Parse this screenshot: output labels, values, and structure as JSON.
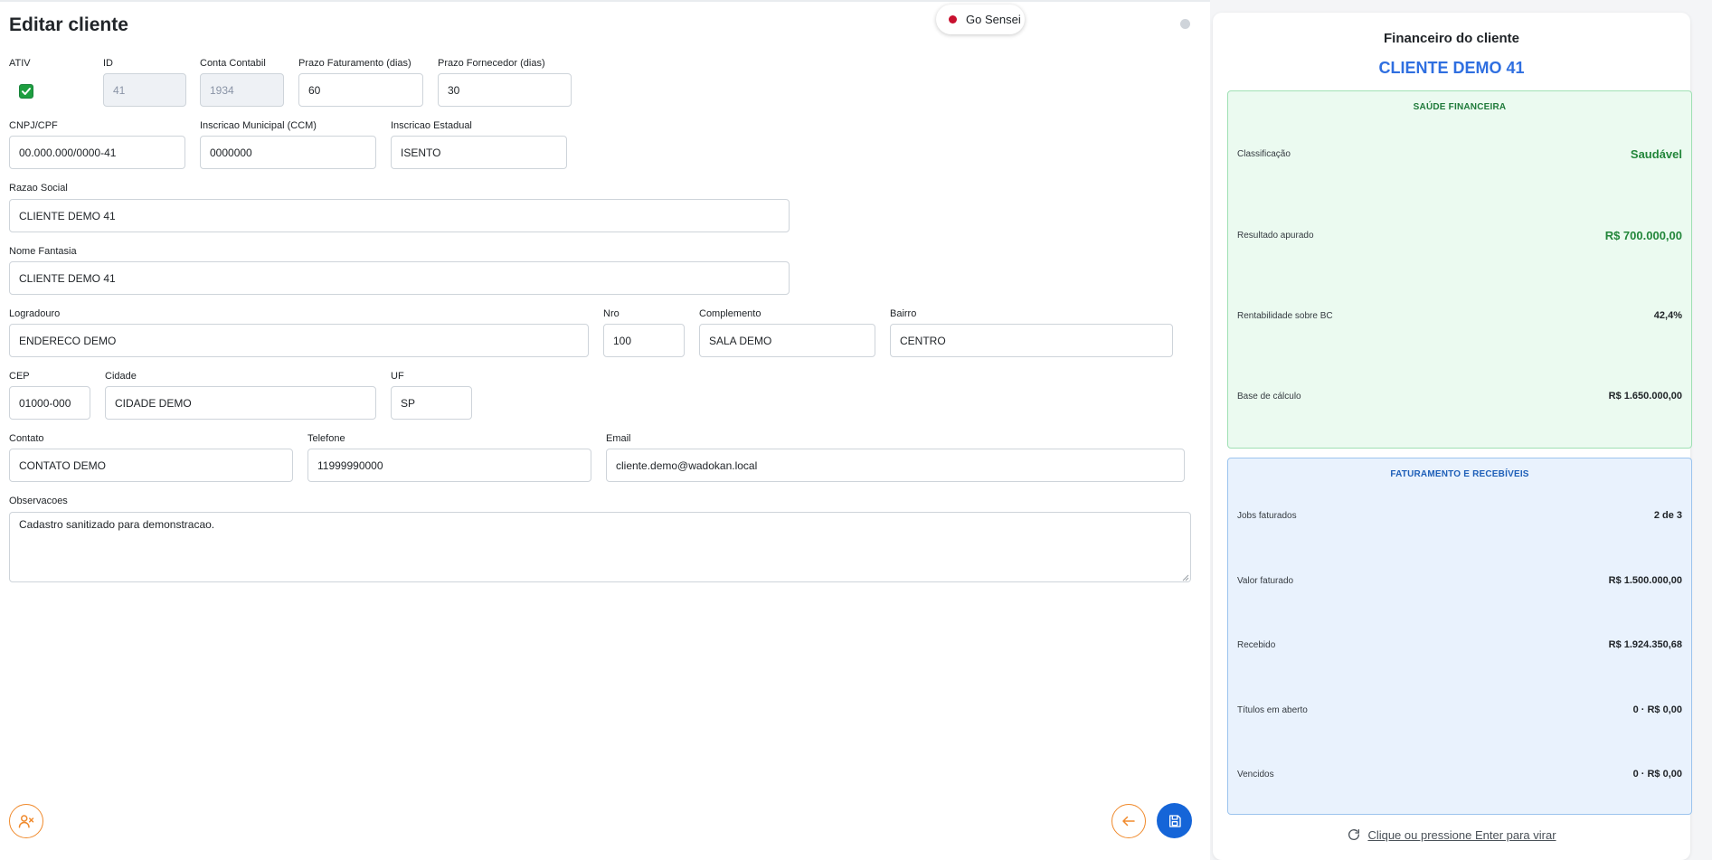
{
  "form": {
    "title": "Editar cliente",
    "fields": {
      "ativ": {
        "label": "ATIV",
        "checked": true
      },
      "id": {
        "label": "ID",
        "value": "41"
      },
      "conta_contabil": {
        "label": "Conta Contabil",
        "value": "1934"
      },
      "prazo_faturamento": {
        "label": "Prazo Faturamento (dias)",
        "value": "60"
      },
      "prazo_fornecedor": {
        "label": "Prazo Fornecedor (dias)",
        "value": "30"
      },
      "cnpj": {
        "label": "CNPJ/CPF",
        "value": "00.000.000/0000-41"
      },
      "insc_municipal": {
        "label": "Inscricao Municipal (CCM)",
        "value": "0000000"
      },
      "insc_estadual": {
        "label": "Inscricao Estadual",
        "value": "ISENTO"
      },
      "razao_social": {
        "label": "Razao Social",
        "value": "CLIENTE DEMO 41"
      },
      "nome_fantasia": {
        "label": "Nome Fantasia",
        "value": "CLIENTE DEMO 41"
      },
      "logradouro": {
        "label": "Logradouro",
        "value": "ENDERECO DEMO"
      },
      "nro": {
        "label": "Nro",
        "value": "100"
      },
      "complemento": {
        "label": "Complemento",
        "value": "SALA DEMO"
      },
      "bairro": {
        "label": "Bairro",
        "value": "CENTRO"
      },
      "cep": {
        "label": "CEP",
        "value": "01000-000"
      },
      "cidade": {
        "label": "Cidade",
        "value": "CIDADE DEMO"
      },
      "uf": {
        "label": "UF",
        "value": "SP"
      },
      "contato": {
        "label": "Contato",
        "value": "CONTATO DEMO"
      },
      "telefone": {
        "label": "Telefone",
        "value": "11999990000"
      },
      "email": {
        "label": "Email",
        "value": "cliente.demo@wadokan.local"
      },
      "observacoes": {
        "label": "Observacoes",
        "value": "Cadastro sanitizado para demonstracao."
      }
    }
  },
  "sensei": {
    "label": "Go Sensei",
    "dot_color": "#c8102e"
  },
  "panel": {
    "title": "Financeiro do cliente",
    "client_name": "CLIENTE DEMO 41",
    "health": {
      "header": "SAÚDE FINANCEIRA",
      "rows": [
        {
          "label": "Classificação",
          "value": "Saudável"
        },
        {
          "label": "Resultado apurado",
          "value": "R$ 700.000,00"
        },
        {
          "label": "Rentabilidade sobre BC",
          "value": "42,4%"
        },
        {
          "label": "Base de cálculo",
          "value": "R$ 1.650.000,00"
        }
      ]
    },
    "billing": {
      "header": "FATURAMENTO E RECEBÍVEIS",
      "rows": [
        {
          "label": "Jobs faturados",
          "value": "2 de 3"
        },
        {
          "label": "Valor faturado",
          "value": "R$ 1.500.000,00"
        },
        {
          "label": "Recebido",
          "value": "R$ 1.924.350,68"
        },
        {
          "label": "Títulos em aberto",
          "value": "0 · R$ 0,00"
        },
        {
          "label": "Vencidos",
          "value": "0 · R$ 0,00"
        }
      ]
    },
    "flip_hint": "Clique ou pressione Enter para virar"
  },
  "colors": {
    "accent": "#2f6fe0",
    "save": "#1565d8",
    "orange": "#f08a2c",
    "healthy": "#22863a"
  }
}
